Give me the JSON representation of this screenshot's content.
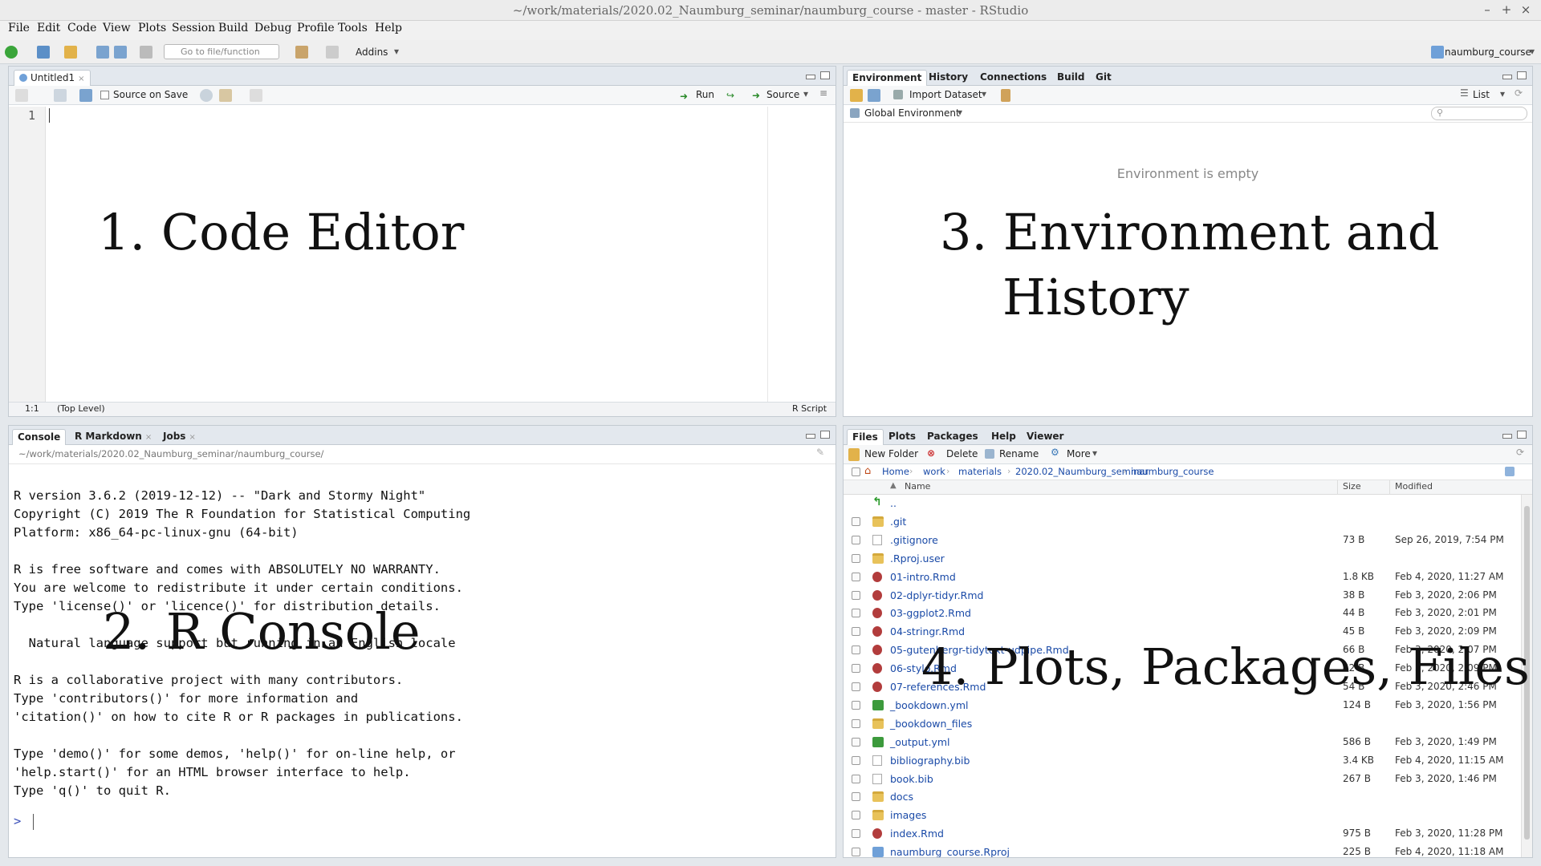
{
  "window": {
    "title": "~/work/materials/2020.02_Naumburg_seminar/naumburg_course - master - RStudio",
    "controls": [
      "–",
      "+",
      "×"
    ]
  },
  "menu": [
    "File",
    "Edit",
    "Code",
    "View",
    "Plots",
    "Session",
    "Build",
    "Debug",
    "Profile",
    "Tools",
    "Help"
  ],
  "toolbar": {
    "goto_placeholder": "Go to file/function",
    "addins": "Addins",
    "project": "naumburg_course"
  },
  "editor": {
    "tab": "Untitled1",
    "source_on_save": "Source on Save",
    "run": "Run",
    "source": "Source",
    "line_number": "1",
    "status_pos": "1:1",
    "status_scope": "(Top Level)",
    "status_type": "R Script"
  },
  "console": {
    "tabs": [
      "Console",
      "R Markdown",
      "Jobs"
    ],
    "path": "~/work/materials/2020.02_Naumburg_seminar/naumburg_course/",
    "lines": [
      "R version 3.6.2 (2019-12-12) -- \"Dark and Stormy Night\"",
      "Copyright (C) 2019 The R Foundation for Statistical Computing",
      "Platform: x86_64-pc-linux-gnu (64-bit)",
      "",
      "R is free software and comes with ABSOLUTELY NO WARRANTY.",
      "You are welcome to redistribute it under certain conditions.",
      "Type 'license()' or 'licence()' for distribution details.",
      "",
      "  Natural language support but running in an English locale",
      "",
      "R is a collaborative project with many contributors.",
      "Type 'contributors()' for more information and",
      "'citation()' on how to cite R or R packages in publications.",
      "",
      "Type 'demo()' for some demos, 'help()' for on-line help, or",
      "'help.start()' for an HTML browser interface to help.",
      "Type 'q()' to quit R."
    ],
    "prompt": ">"
  },
  "environment": {
    "tabs": [
      "Environment",
      "History",
      "Connections",
      "Build",
      "Git"
    ],
    "import_dataset": "Import Dataset",
    "list_label": "List",
    "global_env": "Global Environment",
    "empty_message": "Environment is empty"
  },
  "files": {
    "tabs": [
      "Files",
      "Plots",
      "Packages",
      "Help",
      "Viewer"
    ],
    "actions": {
      "new_folder": "New Folder",
      "delete": "Delete",
      "rename": "Rename",
      "more": "More"
    },
    "breadcrumb": [
      "Home",
      "work",
      "materials",
      "2020.02_Naumburg_seminar",
      "naumburg_course"
    ],
    "columns": {
      "name": "Name",
      "size": "Size",
      "modified": "Modified"
    },
    "rows": [
      {
        "name": "..",
        "size": "",
        "modified": "",
        "icon": "up-arrow-icon"
      },
      {
        "name": ".git",
        "size": "",
        "modified": "",
        "icon": "folder-icon"
      },
      {
        "name": ".gitignore",
        "size": "73 B",
        "modified": "Sep 26, 2019, 7:54 PM",
        "icon": "gitignore-icon"
      },
      {
        "name": ".Rproj.user",
        "size": "",
        "modified": "",
        "icon": "folder-icon"
      },
      {
        "name": "01-intro.Rmd",
        "size": "1.8 KB",
        "modified": "Feb 4, 2020, 11:27 AM",
        "icon": "rmd-icon"
      },
      {
        "name": "02-dplyr-tidyr.Rmd",
        "size": "38 B",
        "modified": "Feb 3, 2020, 2:06 PM",
        "icon": "rmd-icon"
      },
      {
        "name": "03-ggplot2.Rmd",
        "size": "44 B",
        "modified": "Feb 3, 2020, 2:01 PM",
        "icon": "rmd-icon"
      },
      {
        "name": "04-stringr.Rmd",
        "size": "45 B",
        "modified": "Feb 3, 2020, 2:09 PM",
        "icon": "rmd-icon"
      },
      {
        "name": "05-gutenbergr-tidytext-udpipe.Rmd",
        "size": "66 B",
        "modified": "Feb 3, 2020, 2:07 PM",
        "icon": "rmd-icon"
      },
      {
        "name": "06-stylo.Rmd",
        "size": "42 B",
        "modified": "Feb 3, 2020, 2:09 PM",
        "icon": "rmd-icon"
      },
      {
        "name": "07-references.Rmd",
        "size": "54 B",
        "modified": "Feb 3, 2020, 2:46 PM",
        "icon": "rmd-icon"
      },
      {
        "name": "_bookdown.yml",
        "size": "124 B",
        "modified": "Feb 3, 2020, 1:56 PM",
        "icon": "yml-icon"
      },
      {
        "name": "_bookdown_files",
        "size": "",
        "modified": "",
        "icon": "folder-icon"
      },
      {
        "name": "_output.yml",
        "size": "586 B",
        "modified": "Feb 3, 2020, 1:49 PM",
        "icon": "yml-icon"
      },
      {
        "name": "bibliography.bib",
        "size": "3.4 KB",
        "modified": "Feb 4, 2020, 11:15 AM",
        "icon": "doc-icon"
      },
      {
        "name": "book.bib",
        "size": "267 B",
        "modified": "Feb 3, 2020, 1:46 PM",
        "icon": "doc-icon"
      },
      {
        "name": "docs",
        "size": "",
        "modified": "",
        "icon": "folder-icon"
      },
      {
        "name": "images",
        "size": "",
        "modified": "",
        "icon": "folder-icon"
      },
      {
        "name": "index.Rmd",
        "size": "975 B",
        "modified": "Feb 3, 2020, 11:28 PM",
        "icon": "rmd-icon"
      },
      {
        "name": "naumburg_course.Rproj",
        "size": "225 B",
        "modified": "Feb 4, 2020, 11:18 AM",
        "icon": "rproj-icon"
      }
    ]
  },
  "annotations": {
    "code_editor": "1. Code Editor",
    "console": "2. R Console",
    "environment_line1": "3. Environment and",
    "environment_line2": "History",
    "files": "4. Plots, Packages, Files"
  }
}
